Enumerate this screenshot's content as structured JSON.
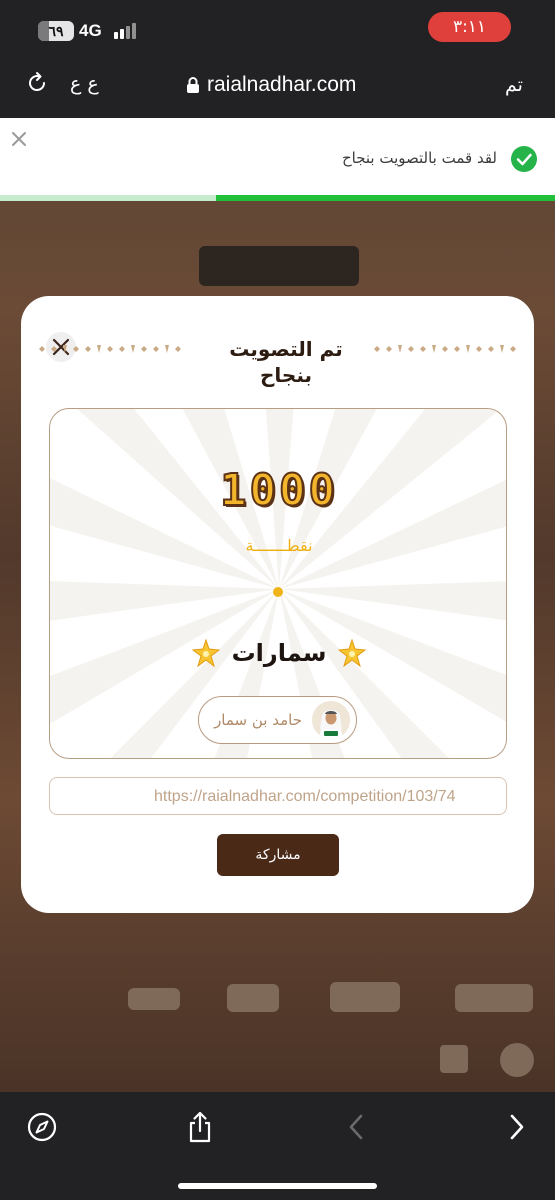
{
  "status_bar": {
    "battery_level": "٦٩",
    "battery_fraction": 0.69,
    "network": "4G",
    "time": "٣:١١"
  },
  "address_bar": {
    "reload_icon": "reload-icon",
    "text_size_label": "ع ع",
    "url": "raialnadhar.com",
    "done_label": "تم"
  },
  "toast": {
    "message": "لقد قمت بالتصويت بنجاح",
    "progress_fraction": 0.61
  },
  "modal": {
    "title": "تم التصويت بنجاح",
    "points": "1000",
    "points_label": "نقطـــــــة",
    "team_name": "سمارات",
    "player_name": "حامد بن سمار",
    "share_link": "https://raialnadhar.com/competition/103/74",
    "share_label": "مشاركة"
  },
  "colors": {
    "accent_brown": "#4a2917",
    "gold": "#f2b52c",
    "success_green": "#25b34a"
  }
}
